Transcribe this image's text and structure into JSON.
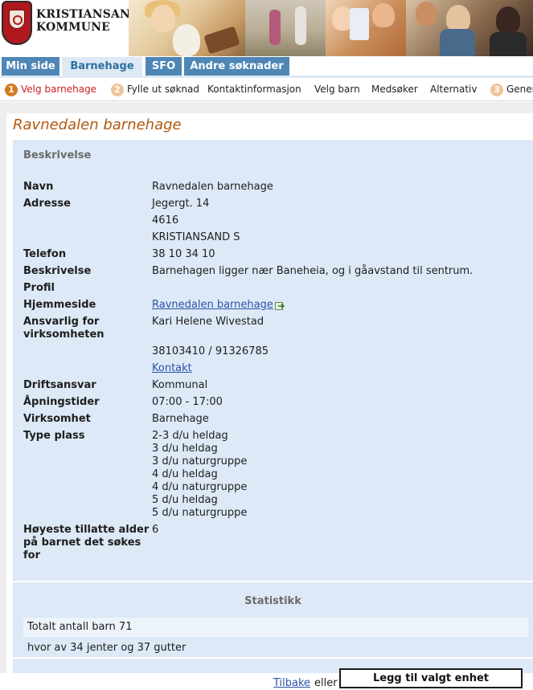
{
  "brand": {
    "line1": "KRISTIANSAND",
    "line2": "KOMMUNE"
  },
  "tabs": [
    {
      "label": "Min side",
      "active": false
    },
    {
      "label": "Barnehage",
      "active": true
    },
    {
      "label": "SFO",
      "active": false
    },
    {
      "label": "Andre søknader",
      "active": false
    }
  ],
  "steps": [
    {
      "number": "1",
      "label": "Velg barnehage",
      "current": true
    },
    {
      "number": "2",
      "label": "Fylle ut søknad",
      "current": false
    },
    {
      "label": "Kontaktinformasjon"
    },
    {
      "label": "Velg barn"
    },
    {
      "label": "Medsøker"
    },
    {
      "label": "Alternativ"
    },
    {
      "number": "3",
      "label": "Gener",
      "current": false
    }
  ],
  "page_title": "Ravnedalen barnehage",
  "description": {
    "heading": "Beskrivelse",
    "labels": {
      "name": "Navn",
      "address": "Adresse",
      "phone": "Telefon",
      "description": "Beskrivelse",
      "profile": "Profil",
      "homepage": "Hjemmeside",
      "responsible_line1": "Ansvarlig for",
      "responsible_line2": "virksomheten",
      "operator": "Driftsansvar",
      "hours": "Åpningstider",
      "business": "Virksomhet",
      "place_type": "Type plass",
      "max_age_line1": "Høyeste tillatte alder",
      "max_age_line2": "på barnet det søkes",
      "max_age_line3": "for"
    },
    "values": {
      "name": "Ravnedalen barnehage",
      "address_line1": "Jegergt. 14",
      "address_line2": "4616",
      "address_line3": "KRISTIANSAND S",
      "phone": "38 10 34 10",
      "description": "Barnehagen ligger nær Baneheia, og i gåavstand til sentrum.",
      "profile": "",
      "homepage_link": "Ravnedalen barnehage",
      "responsible_name": "Kari Helene Wivestad",
      "responsible_phone": "38103410 / 91326785",
      "contact_link": "Kontakt",
      "operator": "Kommunal",
      "hours": "07:00 - 17:00",
      "business": "Barnehage",
      "place_types": [
        "2-3 d/u heldag",
        "3 d/u heldag",
        "3 d/u naturgruppe",
        "4 d/u heldag",
        "4 d/u naturgruppe",
        "5 d/u heldag",
        "5 d/u naturgruppe"
      ],
      "max_age": "6"
    }
  },
  "statistics": {
    "heading": "Statistikk",
    "total": "Totalt antall barn 71",
    "breakdown": "hvor av 34 jenter og 37 gutter"
  },
  "actions": {
    "back_link": "Tilbake",
    "or_text": "eller",
    "add_button": "Legg til valgt enhet"
  },
  "colors": {
    "tab_bg": "#4e86b5",
    "tab_active_bg": "#dde9f4",
    "title": "#b2580e",
    "panel": "#dde9f7",
    "link": "#2a52a8",
    "current_step": "#cc1e1e",
    "step_badge": "#d47a1e"
  }
}
